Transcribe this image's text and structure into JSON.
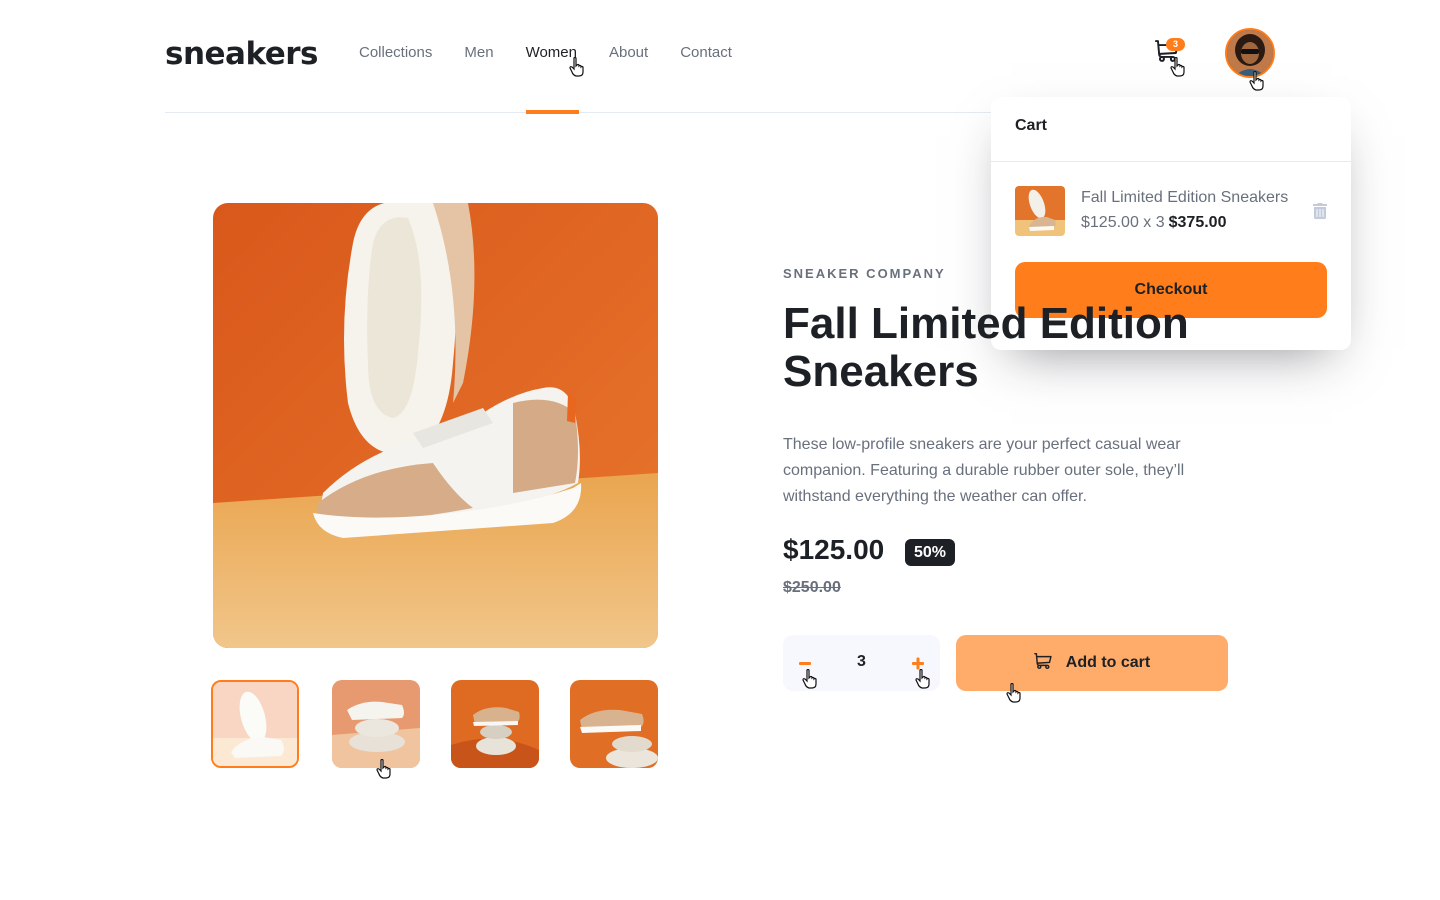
{
  "header": {
    "logo": "sneakers",
    "nav": [
      {
        "label": "Collections",
        "active": false
      },
      {
        "label": "Men",
        "active": false
      },
      {
        "label": "Women",
        "active": true
      },
      {
        "label": "About",
        "active": false
      },
      {
        "label": "Contact",
        "active": false
      }
    ],
    "cart_count": "3",
    "cart_icon": "cart-icon",
    "avatar_icon": "user-avatar"
  },
  "cart": {
    "title": "Cart",
    "item": {
      "name": "Fall Limited Edition Sneakers",
      "unit_price_qty": "$125.00 x 3",
      "total": "$375.00"
    },
    "checkout_label": "Checkout"
  },
  "product": {
    "company": "SNEAKER COMPANY",
    "title": "Fall Limited Edition Sneakers",
    "description": "These low-profile sneakers are your perfect casual wear companion. Featuring a durable rubber outer sole, they’ll withstand everything the weather can offer.",
    "price": "$125.00",
    "discount": "50%",
    "old_price": "$250.00",
    "quantity": "3",
    "add_to_cart_label": "Add to cart"
  },
  "colors": {
    "accent": "#ff7e1b",
    "accent_pale": "#ffab6a",
    "dark": "#1d2025",
    "muted": "#69707d"
  }
}
